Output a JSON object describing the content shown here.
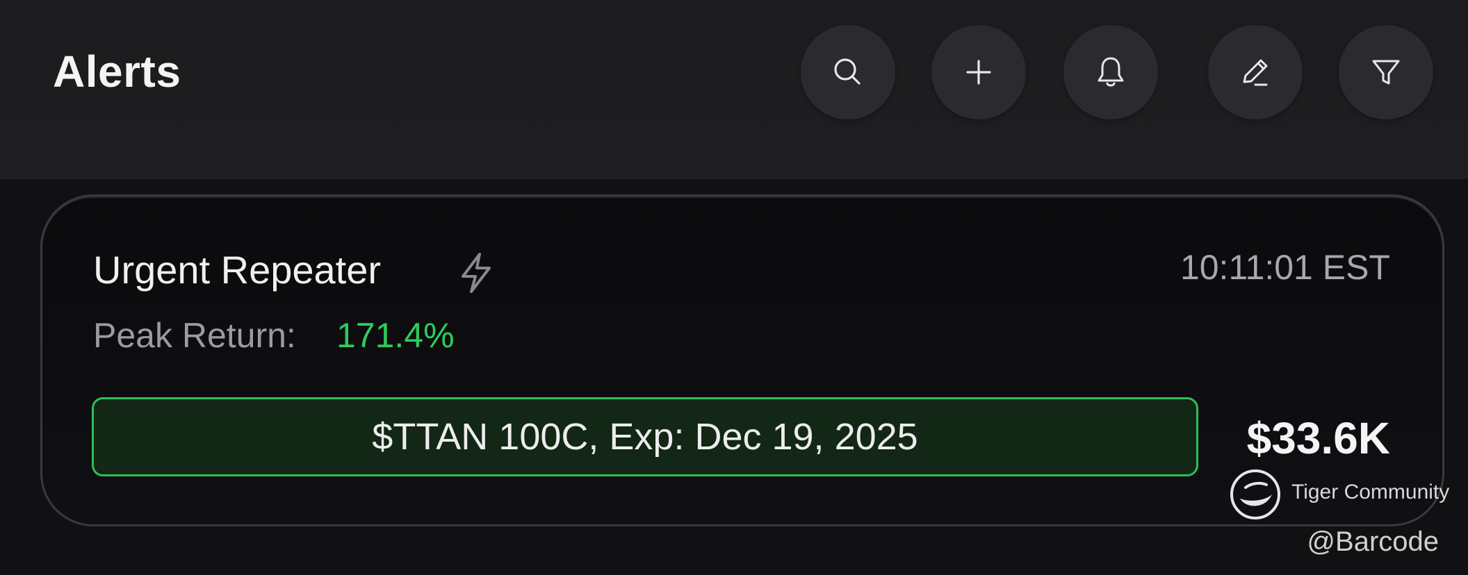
{
  "header": {
    "title": "Alerts",
    "actions": [
      {
        "name": "search-icon"
      },
      {
        "name": "plus-icon"
      },
      {
        "name": "bell-icon"
      },
      {
        "name": "pencil-icon"
      },
      {
        "name": "filter-icon"
      }
    ]
  },
  "alert": {
    "name": "Urgent Repeater",
    "flag_icon": "lightning-bolt-icon",
    "time": "10:11:01 EST",
    "peak_label": "Peak Return:",
    "peak_value": "171.4%",
    "contract": "$TTAN 100C, Exp: Dec 19, 2025",
    "amount": "$33.6K"
  },
  "watermark": {
    "brand": "Tiger Community",
    "handle": "@Barcode"
  },
  "colors": {
    "accent_green": "#2ecc5a",
    "pill_border": "#2fbf56",
    "pill_fill": "#122716",
    "background": "#111113",
    "icon_button": "#2b2b2f"
  }
}
